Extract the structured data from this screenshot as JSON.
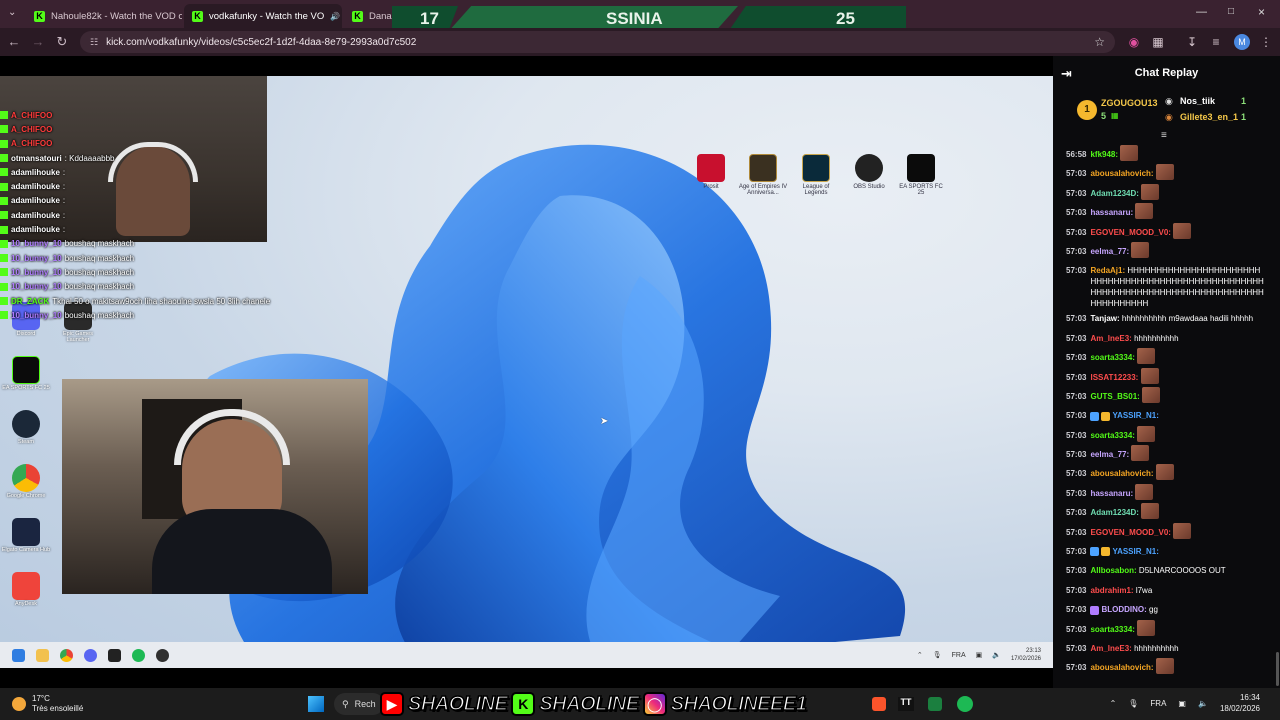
{
  "browser": {
    "tabs": [
      {
        "title": "Nahoule82k - Watch the VOD o",
        "active": false
      },
      {
        "title": "vodkafunky - Watch the VO",
        "active": true
      },
      {
        "title": "DanasT",
        "active": false
      }
    ],
    "url": "kick.com/vodkafunky/videos/c5c5ec2f-1d2f-4daa-8e79-2993a0d7c502",
    "profile_initial": "M"
  },
  "scoreboard": {
    "left_score": "17",
    "team": "SSINIA",
    "right_score": "25"
  },
  "video_chat": [
    {
      "user": "A_CHIFOO",
      "msg": "",
      "color": "#ff3b3b"
    },
    {
      "user": "A_CHIFOO",
      "msg": "",
      "color": "#ff3b3b"
    },
    {
      "user": "A_CHIFOO",
      "msg": "",
      "color": "#ff3b3b"
    },
    {
      "user": "otmansatouri",
      "msg": ": Kddaaaabbb",
      "color": "#ffffff"
    },
    {
      "user": "adamlihouke",
      "msg": ":",
      "color": "#ffffff"
    },
    {
      "user": "adamlihouke",
      "msg": ":",
      "color": "#ffffff"
    },
    {
      "user": "adamlihouke",
      "msg": ":",
      "color": "#ffffff"
    },
    {
      "user": "adamlihouke",
      "msg": ":",
      "color": "#ffffff"
    },
    {
      "user": "adamlihouke",
      "msg": ":",
      "color": "#ffffff"
    },
    {
      "user": "10_bunny_10",
      "msg": "boushaq maskhach",
      "color": "#b07cff"
    },
    {
      "user": "10_bunny_10",
      "msg": "boushaq maskhach",
      "color": "#b07cff"
    },
    {
      "user": "10_bunny_10",
      "msg": "boushaq maskhach",
      "color": "#b07cff"
    },
    {
      "user": "10_bunny_10",
      "msg": "boushaq maskhach",
      "color": "#b07cff"
    },
    {
      "user": "DR_ZACK",
      "msg": "Tkhal 50 o makitsaw9och liha shaoulne swsla 50 3lih chanele",
      "color": "#53fc18"
    },
    {
      "user": "10_bunny_10",
      "msg": "boushaq maskhach",
      "color": "#b07cff"
    }
  ],
  "desktop_icons_top": [
    {
      "label": "Prosit",
      "icon": "app-icon-red"
    },
    {
      "label": "Age of Empires IV Anniversa...",
      "icon": "aoe-icon"
    },
    {
      "label": "League of Legends",
      "icon": "lol-icon"
    },
    {
      "label": "OBS Studio",
      "icon": "obs-icon"
    },
    {
      "label": "EA SPORTS FC 25",
      "icon": "fc-icon"
    }
  ],
  "desktop_icons_left": [
    {
      "label": "Discord"
    },
    {
      "label": "Epic Games Launcher"
    },
    {
      "label": "EA SPORTS FC 25"
    },
    {
      "label": "Steam"
    },
    {
      "label": "Google Chrome"
    },
    {
      "label": "Elgato Camera Hub"
    },
    {
      "label": "AnyDesk"
    }
  ],
  "inner_taskbar": {
    "lang": "FRA",
    "time": "23:13",
    "date": "17/02/2026"
  },
  "chat": {
    "title": "Chat Replay",
    "leaderboard": {
      "rank": "1",
      "top_user": "ZGOUGOU13",
      "top_count": "5",
      "second_user": "Nos_tiik",
      "second_count": "1",
      "third_user": "Gillete3_en_1",
      "third_count": "1"
    },
    "messages": [
      {
        "time": "56:58",
        "user": "kfk948:",
        "color": "#53fc18",
        "text": "",
        "emote": true
      },
      {
        "time": "57:03",
        "user": "abousalahovich:",
        "color": "#f5a623",
        "text": "",
        "emote": true
      },
      {
        "time": "57:03",
        "user": "Adam1234D:",
        "color": "#6fdcb1",
        "text": "",
        "emote": true
      },
      {
        "time": "57:03",
        "user": "hassanaru:",
        "color": "#c7a6ff",
        "text": "",
        "emote": true
      },
      {
        "time": "57:03",
        "user": "EGOVEN_MOOD_V0:",
        "color": "#ff4d4d",
        "text": "",
        "emote": true
      },
      {
        "time": "57:03",
        "user": "eelma_77:",
        "color": "#c7a6ff",
        "text": "",
        "emote": true
      },
      {
        "time": "57:03",
        "user": "RedaAj1:",
        "color": "#f5a623",
        "text": "HHHHHHHHHHHHHHHHHHHHHHHHHHHHHHHHHHHHHHHHHHHHHHHHHHHHHHHHHHHHHHHHHHHHHHHHHHHHHHHHHHHHHHHHHHHHH",
        "emote": false
      },
      {
        "time": "57:03",
        "user": "Tanjaw:",
        "color": "#ffffff",
        "text": "hhhhhhhhhh m9awdaaa hadili hhhhh",
        "emote": false
      },
      {
        "time": "57:03",
        "user": "Am_lneE3:",
        "color": "#ff4d4d",
        "text": "hhhhhhhhhh",
        "emote": false
      },
      {
        "time": "57:03",
        "user": "soarta3334:",
        "color": "#53fc18",
        "text": "",
        "emote": true
      },
      {
        "time": "57:03",
        "user": "ISSAT12233:",
        "color": "#ff4d4d",
        "text": "",
        "emote": true
      },
      {
        "time": "57:03",
        "user": "GUTS_BS01:",
        "color": "#53fc18",
        "text": "",
        "emote": true
      },
      {
        "time": "57:03",
        "user": "YASSIR_N1:",
        "color": "#4da3ff",
        "text": "",
        "emote": false,
        "badges": true
      },
      {
        "time": "57:03",
        "user": "soarta3334:",
        "color": "#53fc18",
        "text": "",
        "emote": true
      },
      {
        "time": "57:03",
        "user": "eelma_77:",
        "color": "#c7a6ff",
        "text": "",
        "emote": true
      },
      {
        "time": "57:03",
        "user": "abousalahovich:",
        "color": "#f5a623",
        "text": "",
        "emote": true
      },
      {
        "time": "57:03",
        "user": "hassanaru:",
        "color": "#c7a6ff",
        "text": "",
        "emote": true
      },
      {
        "time": "57:03",
        "user": "Adam1234D:",
        "color": "#6fdcb1",
        "text": "",
        "emote": true
      },
      {
        "time": "57:03",
        "user": "EGOVEN_MOOD_V0:",
        "color": "#ff4d4d",
        "text": "",
        "emote": true
      },
      {
        "time": "57:03",
        "user": "YASSIR_N1:",
        "color": "#4da3ff",
        "text": "",
        "emote": false,
        "badges": true
      },
      {
        "time": "57:03",
        "user": "Allbosabon:",
        "color": "#53fc18",
        "text": "D5LNARCOOOOS OUT",
        "emote": false
      },
      {
        "time": "57:03",
        "user": "abdrahim1:",
        "color": "#ff4d4d",
        "text": "l7wa",
        "emote": false
      },
      {
        "time": "57:03",
        "user": "BLODDINO:",
        "color": "#c7a6ff",
        "text": "gg",
        "emote": false,
        "badgeSub": true
      },
      {
        "time": "57:03",
        "user": "soarta3334:",
        "color": "#53fc18",
        "text": "",
        "emote": true
      },
      {
        "time": "57:03",
        "user": "Am_lneE3:",
        "color": "#ff4d4d",
        "text": "hhhhhhhhhh",
        "emote": false
      },
      {
        "time": "57:03",
        "user": "abousalahovich:",
        "color": "#f5a623",
        "text": "",
        "emote": true
      }
    ]
  },
  "os_taskbar": {
    "temp": "17°C",
    "weather": "Très ensoleillé",
    "search": "Rech",
    "handles": [
      "SHAOLINE",
      "SHAOLINE",
      "SHAOLINEEE1"
    ],
    "lang": "FRA",
    "time": "16:34",
    "date": "18/02/2026"
  },
  "colors": {
    "kick_green": "#53fc18",
    "chrome_bg": "#3a2230"
  }
}
